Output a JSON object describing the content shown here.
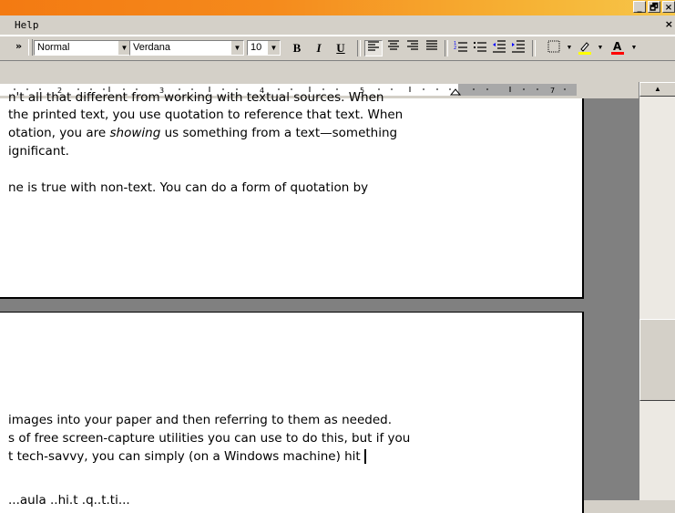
{
  "window": {
    "minimize_label": "_",
    "restore_label": "🗗",
    "close_label": "×"
  },
  "menu": {
    "items": [
      {
        "label": "Help"
      }
    ],
    "doc_close_label": "×"
  },
  "toolbar": {
    "style": "Normal",
    "font": "Verdana",
    "size": "10",
    "bold": "B",
    "italic": "I",
    "underline": "U"
  },
  "ruler": {
    "numbers": [
      "2",
      "3",
      "4",
      "5",
      "7"
    ]
  },
  "page1": {
    "lines": [
      "n't all that different from working with textual sources.  When",
      "the printed text, you use quotation to reference that text.  When",
      "otation, you are showing us something from a text—something",
      "ignificant.",
      "",
      "ne is true with non-text.  You can do a form of quotation by"
    ]
  },
  "page2": {
    "lines": [
      " images into your paper and then referring to them as needed.",
      "s of free screen-capture utilities you can use to do this, but if you",
      "t tech-savvy, you can simply (on a Windows machine) hit",
      "",
      "...aula ..hi.t .q..t.ti..."
    ]
  },
  "colors": {
    "titlebar": "#f37a12",
    "chrome": "#d4d0c8",
    "docbg": "#808080"
  }
}
